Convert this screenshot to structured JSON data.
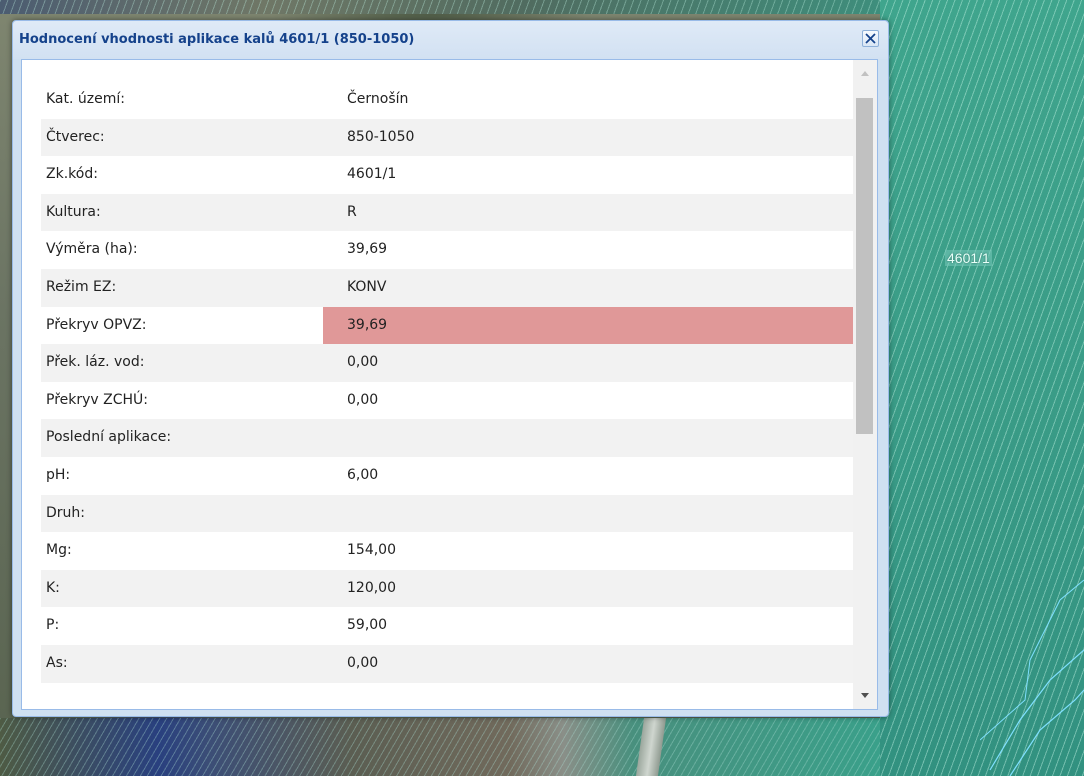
{
  "dialog": {
    "title": "Hodnocení vhodnosti aplikace kalů 4601/1 (850-1050)",
    "close_icon": "close-icon",
    "highlight_color": "#e09898"
  },
  "map": {
    "parcel_label": "4601/1"
  },
  "rows": [
    {
      "label": "Kat. území:",
      "value": "Černošín"
    },
    {
      "label": "Čtverec:",
      "value": "850-1050"
    },
    {
      "label": "Zk.kód:",
      "value": "4601/1"
    },
    {
      "label": "Kultura:",
      "value": "R"
    },
    {
      "label": "Výměra (ha):",
      "value": "39,69"
    },
    {
      "label": "Režim EZ:",
      "value": "KONV"
    },
    {
      "label": "Překryv OPVZ:",
      "value": "39,69",
      "highlight": true
    },
    {
      "label": "Přek. láz. vod:",
      "value": "0,00"
    },
    {
      "label": "Překryv ZCHÚ:",
      "value": "0,00"
    },
    {
      "label": "Poslední aplikace:",
      "value": ""
    },
    {
      "label": "pH:",
      "value": "6,00"
    },
    {
      "label": "Druh:",
      "value": ""
    },
    {
      "label": "Mg:",
      "value": "154,00"
    },
    {
      "label": "K:",
      "value": "120,00"
    },
    {
      "label": "P:",
      "value": "59,00"
    },
    {
      "label": "As:",
      "value": "0,00"
    }
  ]
}
